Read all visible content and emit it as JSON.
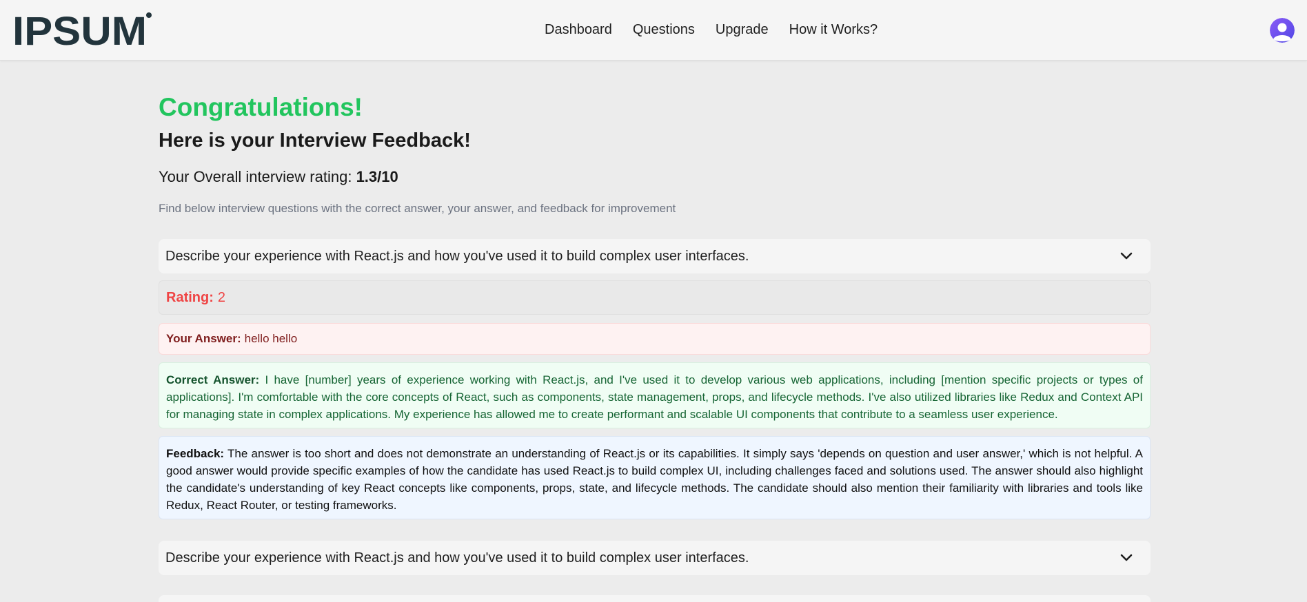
{
  "header": {
    "logo_text": "IPSUM",
    "nav": [
      "Dashboard",
      "Questions",
      "Upgrade",
      "How it Works?"
    ],
    "avatar_icon": "user-avatar-icon",
    "avatar_color": "#6366f1"
  },
  "page": {
    "congrats": "Congratulations!",
    "heading": "Here is your Interview Feedback!",
    "overall_label": "Your Overall interview rating:",
    "overall_value": "1.3/10",
    "intro": "Find below interview questions with the correct answer, your answer, and feedback for improvement"
  },
  "questions": [
    {
      "text": "Describe your experience with React.js and how you've used it to build complex user interfaces.",
      "rating_label": "Rating:",
      "rating_value": "2",
      "your_answer_label": "Your Answer:",
      "your_answer": "hello hello",
      "correct_label": "Correct Answer:",
      "correct_answer": "I have [number] years of experience working with React.js, and I've used it to develop various web applications, including [mention specific projects or types of applications]. I'm comfortable with the core concepts of React, such as components, state management, props, and lifecycle methods. I've also utilized libraries like Redux and Context API for managing state in complex applications. My experience has allowed me to create performant and scalable UI components that contribute to a seamless user experience.",
      "feedback_label": "Feedback:",
      "feedback": "The answer is too short and does not demonstrate an understanding of React.js or its capabilities. It simply says 'depends on question and user answer,' which is not helpful. A good answer would provide specific examples of how the candidate has used React.js to build complex UI, including challenges faced and solutions used. The answer should also highlight the candidate's understanding of key React concepts like components, props, state, and lifecycle methods. The candidate should also mention their familiarity with libraries and tools like Redux, React Router, or testing frameworks."
    },
    {
      "text": "Describe your experience with React.js and how you've used it to build complex user interfaces."
    }
  ],
  "colors": {
    "success": "#22c55e",
    "rating": "#ef4444",
    "answer_bg": "#fef2f2",
    "correct_bg": "#f0fdf4",
    "feedback_bg": "#eff6ff"
  }
}
